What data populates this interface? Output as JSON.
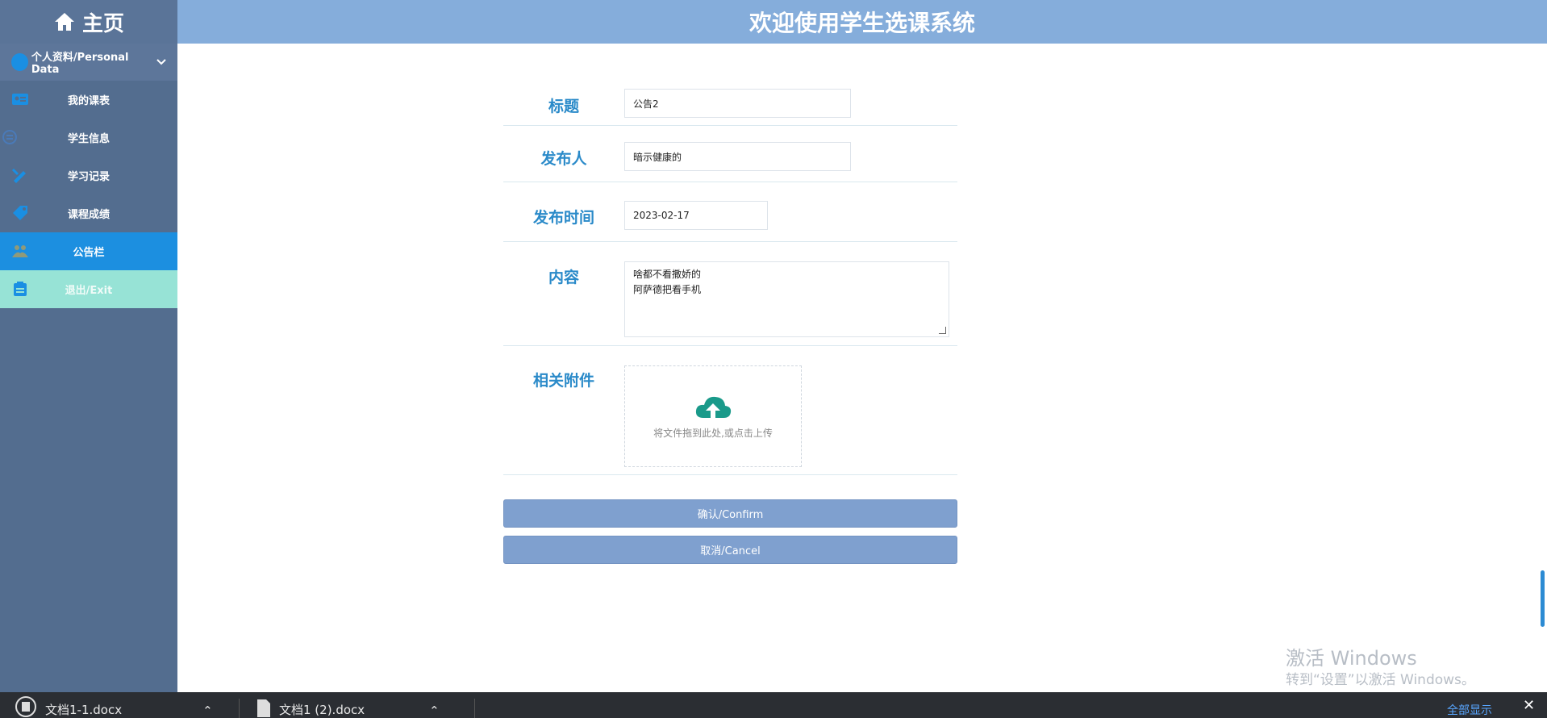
{
  "header": {
    "home_label": "主页",
    "title": "欢迎使用学生选课系统"
  },
  "sidebar": {
    "section_label": "个人资料/Personal Data",
    "items": [
      {
        "label": "我的课表",
        "icon": "id-card-icon"
      },
      {
        "label": "学生信息",
        "icon": "info-icon"
      },
      {
        "label": "学习记录",
        "icon": "pencil-ruler-icon"
      },
      {
        "label": "课程成绩",
        "icon": "tag-icon"
      },
      {
        "label": "公告栏",
        "icon": "group-icon",
        "active": true
      },
      {
        "label": "退出/Exit",
        "icon": "clipboard-icon"
      }
    ]
  },
  "form": {
    "title_label": "标题",
    "title_value": "公告2",
    "publisher_label": "发布人",
    "publisher_value": "暗示健康的",
    "date_label": "发布时间",
    "date_value": "2023-02-17",
    "content_label": "内容",
    "content_line1": "啥都不看撒娇的",
    "content_line2": "阿萨德把看手机",
    "attachment_label": "相关附件",
    "upload_hint": "将文件拖到此处,或点击上传",
    "confirm_label": "确认/Confirm",
    "cancel_label": "取消/Cancel"
  },
  "watermark": {
    "line1": "激活 Windows",
    "line2": "转到“设置”以激活 Windows。"
  },
  "taskbar": {
    "item1": "文档1-1.docx",
    "item2": "文档1 (2).docx",
    "show_all": "全部显示"
  },
  "colors": {
    "topbar": "#85addb",
    "sidebar": "#536d8f",
    "active_item": "#1c8fe0",
    "exit_item": "#97e3d6",
    "label_blue": "#2a8ac9",
    "button": "#7fa0cf",
    "upload_icon": "#1a9a8a"
  }
}
